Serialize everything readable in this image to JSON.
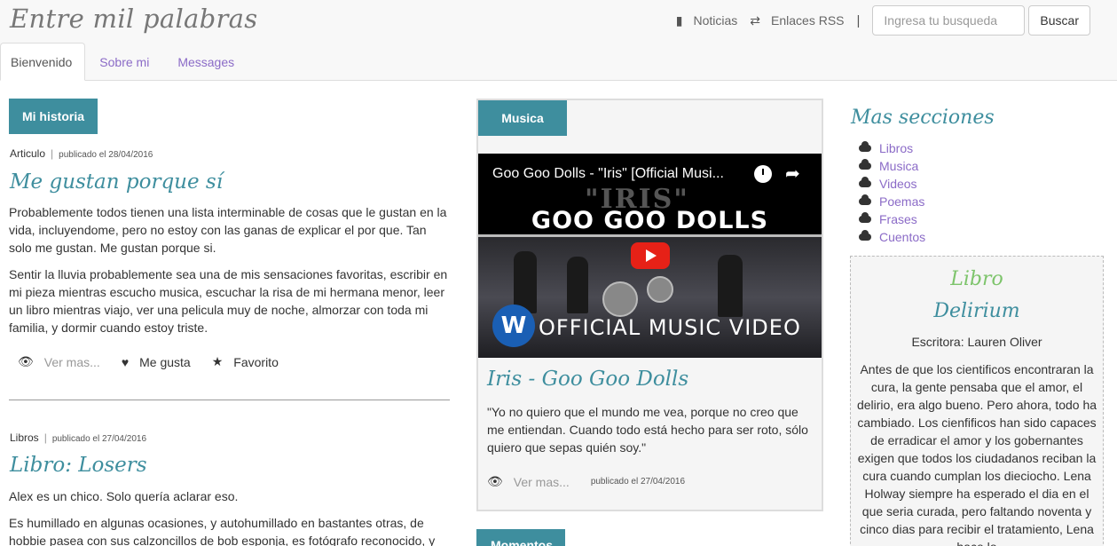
{
  "header": {
    "brand": "Entre mil palabras",
    "links": [
      {
        "label": "Noticias",
        "icon": "book-icon"
      },
      {
        "label": "Enlaces RSS",
        "icon": "shuffle-icon"
      }
    ],
    "separator": "|",
    "search_placeholder": "Ingresa tu busqueda",
    "search_button": "Buscar"
  },
  "tabs": [
    {
      "label": "Bienvenido",
      "active": true
    },
    {
      "label": "Sobre mi",
      "active": false
    },
    {
      "label": "Messages",
      "active": false
    }
  ],
  "left": {
    "section_label": "Mi historia",
    "posts": [
      {
        "category": "Articulo",
        "date": "publicado el 28/04/2016",
        "title": "Me gustan porque sí",
        "paragraphs": [
          "Probablemente todos tienen una lista interminable de cosas que le gustan en la vida, incluyendome, pero no estoy con las ganas de explicar el por que. Tan solo me gustan. Me gustan porque si.",
          "Sentir la lluvia probablemente sea una de mis sensaciones favoritas, escribir en mi pieza mientras escucho musica, escuchar la risa de mi hermana menor, leer un libro mientras viajo, ver una pelicula muy de noche, almorzar con toda mi familia, y dormir cuando estoy triste."
        ],
        "actions": {
          "view": "Ver mas...",
          "like": "Me gusta",
          "fav": "Favorito"
        }
      },
      {
        "category": "Libros",
        "date": "publicado el 27/04/2016",
        "title": "Libro: Losers",
        "paragraphs": [
          "Alex es un chico. Solo quería aclarar eso.",
          "Es humillado en algunas ocasiones, y autohumillado en bastantes otras, de hobbie pasea con sus calzoncillos de bob esponja, es fotógrafo reconocido, y"
        ]
      }
    ]
  },
  "middle": {
    "section_label": "Musica",
    "video": {
      "title": "Goo Goo Dolls - \"Iris\" [Official Musi...",
      "band": "GOO GOO DOLLS",
      "song": "\"IRIS\"",
      "overlay": "OFFICIAL MUSIC VIDEO",
      "logo": "W"
    },
    "title": "Iris - Goo Goo Dolls",
    "quote": "\"Yo no quiero que el mundo me vea, porque no creo que me entiendan. Cuando todo está hecho para ser roto, sólo quiero que sepas quién soy.\"",
    "view": "Ver mas...",
    "date": "publicado el 27/04/2016",
    "next_label": "Momentos"
  },
  "right": {
    "title": "Mas secciones",
    "sections": [
      "Libros",
      "Musica",
      "Videos",
      "Poemas",
      "Frases",
      "Cuentos"
    ],
    "book": {
      "kicker": "Libro",
      "title": "Delirium",
      "author": "Escritora: Lauren Oliver",
      "description": "Antes de que los cientificos encontraran la cura, la gente pensaba que el amor, el delirio, era algo bueno. Pero ahora, todo ha cambiado. Los cienfificos han sido capaces de erradicar el amor y los gobernantes exigen que todos los ciudadanos reciban la cura cuando cumplan los dieciocho. Lena Holway siempre ha esperado el dia en el que seria curada, pero faltando noventa y cinco dias para recibir el tratamiento, Lena hace lo"
    }
  },
  "colors": {
    "accent": "#3e8e9e",
    "link": "#8b6bc7",
    "kicker": "#7dc46b"
  }
}
